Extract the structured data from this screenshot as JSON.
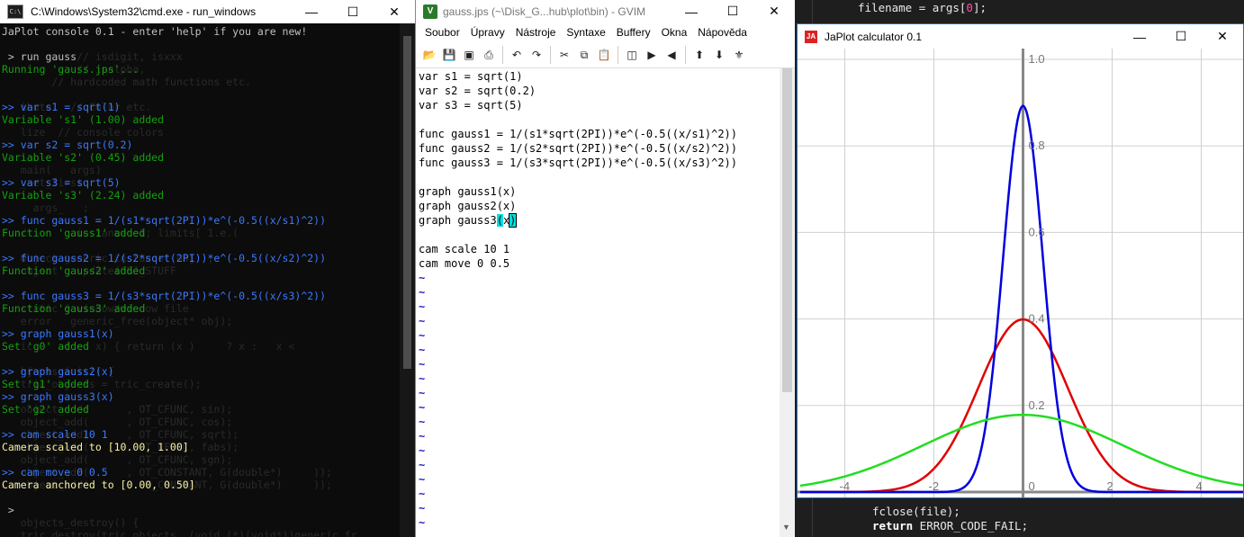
{
  "cmd": {
    "title": "C:\\Windows\\System32\\cmd.exe - run_windows",
    "lines": [
      {
        "text": "JaPlot console 0.1 - enter 'help' if you are new!",
        "kind": "c-head"
      },
      {
        "text": "",
        "kind": "c-plain"
      },
      {
        "text": " > run gauss",
        "kind": "c-plain"
      },
      {
        "text": "Running 'gauss.jps'...",
        "kind": "c-out"
      },
      {
        "text": "",
        "kind": "c-plain"
      },
      {
        "text": "",
        "kind": "c-plain"
      },
      {
        "text": ">> var s1 = sqrt(1)",
        "kind": "c-prompt"
      },
      {
        "text": "Variable 's1' (1.00) added",
        "kind": "c-out"
      },
      {
        "text": "",
        "kind": "c-plain"
      },
      {
        "text": ">> var s2 = sqrt(0.2)",
        "kind": "c-prompt"
      },
      {
        "text": "Variable 's2' (0.45) added",
        "kind": "c-out"
      },
      {
        "text": "",
        "kind": "c-plain"
      },
      {
        "text": ">> var s3 = sqrt(5)",
        "kind": "c-prompt"
      },
      {
        "text": "Variable 's3' (2.24) added",
        "kind": "c-out"
      },
      {
        "text": "",
        "kind": "c-plain"
      },
      {
        "text": ">> func gauss1 = 1/(s1*sqrt(2PI))*e^(-0.5((x/s1)^2))",
        "kind": "c-prompt"
      },
      {
        "text": "Function 'gauss1' added",
        "kind": "c-out"
      },
      {
        "text": "",
        "kind": "c-plain"
      },
      {
        "text": ">> func gauss2 = 1/(s2*sqrt(2PI))*e^(-0.5((x/s2)^2))",
        "kind": "c-prompt"
      },
      {
        "text": "Function 'gauss2' added",
        "kind": "c-out"
      },
      {
        "text": "",
        "kind": "c-plain"
      },
      {
        "text": ">> func gauss3 = 1/(s3*sqrt(2PI))*e^(-0.5((x/s3)^2))",
        "kind": "c-prompt"
      },
      {
        "text": "Function 'gauss3' added",
        "kind": "c-out"
      },
      {
        "text": "",
        "kind": "c-plain"
      },
      {
        "text": ">> graph gauss1(x)",
        "kind": "c-prompt"
      },
      {
        "text": "Set 'g0' added",
        "kind": "c-out"
      },
      {
        "text": "",
        "kind": "c-plain"
      },
      {
        "text": ">> graph gauss2(x)",
        "kind": "c-prompt"
      },
      {
        "text": "Set 'g1' added",
        "kind": "c-out"
      },
      {
        "text": ">> graph gauss3(x)",
        "kind": "c-prompt"
      },
      {
        "text": "Set 'g2' added",
        "kind": "c-out"
      },
      {
        "text": "",
        "kind": "c-plain"
      },
      {
        "text": ">> cam scale 10 1",
        "kind": "c-prompt"
      },
      {
        "text": "Camera scaled to [10.00, 1.00]",
        "kind": "c-cam"
      },
      {
        "text": "",
        "kind": "c-plain"
      },
      {
        "text": ">> cam move 0 0.5",
        "kind": "c-prompt"
      },
      {
        "text": "Camera anchored to [0.00, 0.50]",
        "kind": "c-cam"
      },
      {
        "text": "",
        "kind": "c-plain"
      },
      {
        "text": " >",
        "kind": "c-plain"
      }
    ],
    "ghost_lines": [
      "",
      "",
      "            // isdigit, isxxx",
      "            // isalpha,",
      "        // hardcoded math functions etc.",
      "",
      "   ibute   // Color etc.",
      "",
      "   lize  // console colors",
      "",
      "",
      "   main(   args)",
      "   _set_first",
      "",
      "     args_   ;",
      "",
      "   /        instance  1; limits[ 1.e.(",
      "",
      "   Object generic instance( obj );",
      "   object   update(OBJ_STUFF",
      "",
      "",
      "   static ( window/window file",
      "   error   generic_free(object* obj);",
      "",
      "   ic     (    x) { return (x )     ? x :   x <",
      "",
      "   hjects_init() {",
      "   tric_objects = tric_create();",
      "",
      "   object_add(      , OT_CFUNC, sin);",
      "   object_add(      , OT_CFUNC, cos);",
      "   object_add(      , OT_CFUNC, sqrt);",
      "   object_add(      , OT_CFUNC, fabs);",
      "   object_add(      , OT_CFUNC, sgn);",
      "   object_add(      , OT_CONSTANT, G(double*)     ));",
      "   object_add(      , OT_CONSTANT, G(double*)     ));",
      "",
      "",
      "   objects_destroy() {",
      "   tric_destroy(tric_objects, (void (*)(void*))generic_fr"
    ]
  },
  "gvim": {
    "title": "gauss.jps (~\\Disk_G...hub\\plot\\bin) - GVIM",
    "menu": [
      "Soubor",
      "Úpravy",
      "Nástroje",
      "Syntaxe",
      "Buffery",
      "Okna",
      "Nápověda"
    ],
    "lines": [
      "var s1 = sqrt(1)",
      "var s2 = sqrt(0.2)",
      "var s3 = sqrt(5)",
      "",
      "func gauss1 = 1/(s1*sqrt(2PI))*e^(-0.5((x/s1)^2))",
      "func gauss2 = 1/(s2*sqrt(2PI))*e^(-0.5((x/s2)^2))",
      "func gauss3 = 1/(s3*sqrt(2PI))*e^(-0.5((x/s3)^2))",
      "",
      "graph gauss1(x)",
      "graph gauss2(x)",
      "graph gauss3(x)",
      "",
      "cam scale 10 1",
      "cam move 0 0.5"
    ],
    "tilde_count": 18,
    "tilde": "~"
  },
  "bg_editor": {
    "top_line_a": "filename = args[",
    "top_line_idx": "0",
    "top_line_b": "];",
    "bottom_line1": "fclose(file);",
    "bottom_kw": "return",
    "bottom_rest": " ERROR_CODE_FAIL;"
  },
  "japlot": {
    "title": "JaPlot calculator 0.1",
    "colors": {
      "axis": "#888888",
      "grid": "#cfcfcf",
      "gauss1": "#e00000",
      "gauss2": "#0000e0",
      "gauss3": "#22dd22"
    },
    "y_labels": [
      "1.0",
      "0.8",
      "0.6",
      "0.4",
      "0.2",
      "0"
    ],
    "x_labels": [
      "-4",
      "-2",
      "2",
      "4"
    ]
  },
  "chart_data": {
    "type": "line",
    "series": [
      {
        "name": "gauss1",
        "sigma": 1.0,
        "color": "#e00000"
      },
      {
        "name": "gauss2",
        "sigma": 0.447,
        "color": "#0000e0"
      },
      {
        "name": "gauss3",
        "sigma": 2.236,
        "color": "#22dd22"
      }
    ],
    "xlim": [
      -5,
      5
    ],
    "ylim": [
      0,
      1.0
    ],
    "x_ticks": [
      -4,
      -2,
      2,
      4
    ],
    "y_ticks": [
      0.2,
      0.4,
      0.6,
      0.8,
      1.0
    ]
  }
}
